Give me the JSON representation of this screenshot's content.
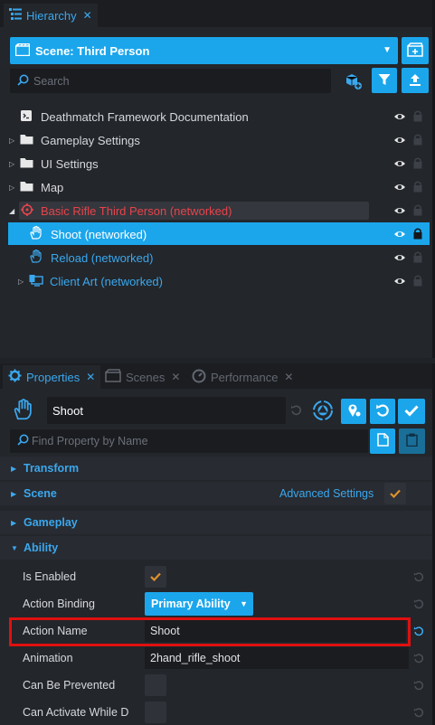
{
  "hierarchy": {
    "tab_label": "Hierarchy",
    "scene_label": "Scene: Third Person",
    "search_placeholder": "Search",
    "items": [
      {
        "label": "Deathmatch Framework Documentation",
        "type": "script",
        "expandable": false
      },
      {
        "label": "Gameplay Settings",
        "type": "folder",
        "expandable": true
      },
      {
        "label": "UI Settings",
        "type": "folder",
        "expandable": true
      },
      {
        "label": "Map",
        "type": "folder",
        "expandable": true
      },
      {
        "label": "Basic Rifle Third Person (networked)",
        "type": "equipment",
        "expandable": true,
        "expanded": true
      },
      {
        "label": "Shoot (networked)",
        "type": "ability",
        "selected": true
      },
      {
        "label": "Reload (networked)",
        "type": "ability"
      },
      {
        "label": "Client Art (networked)",
        "type": "client-context",
        "expandable": true
      }
    ]
  },
  "properties": {
    "tabs": [
      {
        "label": "Properties",
        "active": true
      },
      {
        "label": "Scenes",
        "active": false
      },
      {
        "label": "Performance",
        "active": false
      }
    ],
    "object_name": "Shoot",
    "find_placeholder": "Find Property by Name",
    "sections": {
      "transform": "Transform",
      "scene": "Scene",
      "advanced_settings": "Advanced Settings",
      "gameplay": "Gameplay",
      "ability": "Ability"
    },
    "fields": {
      "is_enabled_label": "Is Enabled",
      "action_binding_label": "Action Binding",
      "action_binding_value": "Primary Ability",
      "action_name_label": "Action Name",
      "action_name_value": "Shoot",
      "animation_label": "Animation",
      "animation_value": "2hand_rifle_shoot",
      "can_be_prevented_label": "Can Be Prevented",
      "can_activate_label": "Can Activate While D"
    }
  },
  "colors": {
    "accent": "#1ba6ec",
    "networked_red": "#e8434b",
    "highlight_box": "#e01010",
    "check_orange": "#e0912c"
  }
}
